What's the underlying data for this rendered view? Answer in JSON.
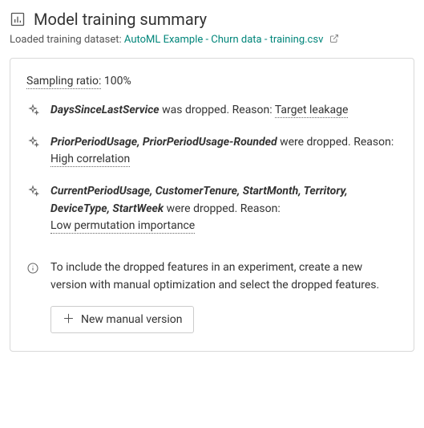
{
  "header": {
    "title": "Model training summary",
    "subtitle_prefix": "Loaded training dataset: ",
    "dataset_name": "AutoML Example - Churn data - training.csv"
  },
  "card": {
    "sampling_label": "Sampling ratio:",
    "sampling_value": "100%",
    "drops": [
      {
        "features": "DaysSinceLastService",
        "verb": " was dropped. Reason: ",
        "reason": "Target leakage",
        "reason_inline": true
      },
      {
        "features": "PriorPeriodUsage, PriorPeriodUsage-Rounded",
        "verb": " were dropped. Reason:",
        "reason": "High correlation",
        "reason_inline": false
      },
      {
        "features": "CurrentPeriodUsage, CustomerTenure, StartMonth, Territory, DeviceType, StartWeek",
        "verb": " were dropped. Reason:",
        "reason": "Low permutation importance",
        "reason_inline": false
      }
    ],
    "info_text": "To include the dropped features in an experiment, create a new version with manual optimization and select the dropped features.",
    "button_label": "New manual version"
  }
}
